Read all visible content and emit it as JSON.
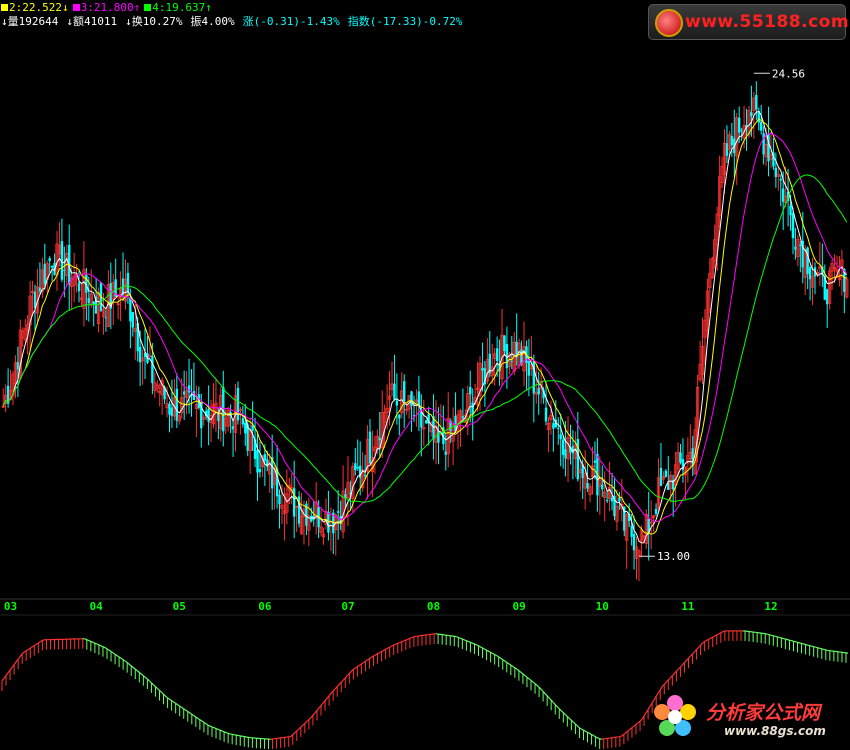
{
  "header": {
    "row1": [
      {
        "label": "2:22.522",
        "arrow": "↓",
        "color": "#ffff00"
      },
      {
        "label": "3:21.800",
        "arrow": "↑",
        "color": "#ff00ff"
      },
      {
        "label": "4:19.637",
        "arrow": "↑",
        "color": "#00ff00"
      }
    ],
    "row2": [
      {
        "label": "量192644",
        "arrow": "↓",
        "color": "#ffffff"
      },
      {
        "label": "额41011",
        "arrow": "↓",
        "color": "#ffffff"
      },
      {
        "label": "换10.27%",
        "arrow": "↓",
        "color": "#ffffff"
      },
      {
        "label": "振4.00%",
        "arrow": "",
        "color": "#ffffff"
      },
      {
        "label": "涨(-0.31)-1.43%",
        "arrow": "",
        "color": "#00ffff"
      },
      {
        "label": "指数(-17.33)-0.72%",
        "arrow": "",
        "color": "#00ffff"
      }
    ]
  },
  "watermarks": {
    "top_right": "www.55188.com",
    "bottom_right": "分析家公式网",
    "bottom_url": "www.88gs.com"
  },
  "colors": {
    "up": "#ff3232",
    "down": "#00ffff",
    "ma_short": "#ffffff",
    "ma2": "#ffff00",
    "ma3": "#ff00ff",
    "ma4": "#00ff00",
    "axis_label": "#00ff00",
    "osc_up": "#ff3232",
    "osc_down": "#66ff66"
  },
  "chart_data": {
    "type": "candlestick",
    "x_month_labels": [
      "03",
      "04",
      "05",
      "06",
      "07",
      "08",
      "09",
      "10",
      "11",
      "12"
    ],
    "ylim": [
      12.0,
      25.5
    ],
    "annotations": [
      {
        "text": "24.56",
        "value": 24.56,
        "kind": "high"
      },
      {
        "text": "13.00",
        "value": 13.0,
        "kind": "low"
      }
    ],
    "close_anchors": [
      [
        0,
        16.6
      ],
      [
        4,
        17.4
      ],
      [
        12,
        19.2
      ],
      [
        20,
        20.2
      ],
      [
        30,
        19.6
      ],
      [
        40,
        19.0
      ],
      [
        50,
        19.4
      ],
      [
        58,
        17.6
      ],
      [
        68,
        16.6
      ],
      [
        80,
        16.5
      ],
      [
        95,
        16.4
      ],
      [
        108,
        15.0
      ],
      [
        120,
        14.2
      ],
      [
        135,
        13.9
      ],
      [
        148,
        15.3
      ],
      [
        158,
        16.8
      ],
      [
        168,
        16.4
      ],
      [
        178,
        15.6
      ],
      [
        188,
        16.3
      ],
      [
        200,
        17.8
      ],
      [
        210,
        18.0
      ],
      [
        222,
        16.6
      ],
      [
        235,
        15.2
      ],
      [
        245,
        14.8
      ],
      [
        255,
        13.6
      ],
      [
        262,
        13.4
      ],
      [
        268,
        14.5
      ],
      [
        275,
        15.0
      ],
      [
        282,
        15.5
      ],
      [
        290,
        20.5
      ],
      [
        295,
        22.5
      ],
      [
        305,
        23.8
      ],
      [
        315,
        22.5
      ],
      [
        325,
        20.6
      ],
      [
        335,
        19.4
      ],
      [
        345,
        19.8
      ]
    ],
    "ma_periods": [
      5,
      10,
      20,
      40
    ],
    "oscillator": {
      "type": "histogram",
      "values": [
        0.1,
        0.6,
        0.84,
        0.85,
        0.86,
        0.7,
        0.45,
        0.15,
        -0.2,
        -0.45,
        -0.7,
        -0.85,
        -0.92,
        -0.95,
        -0.9,
        -0.55,
        -0.1,
        0.3,
        0.55,
        0.75,
        0.9,
        0.95,
        0.9,
        0.75,
        0.55,
        0.3,
        0.0,
        -0.4,
        -0.75,
        -0.95,
        -0.9,
        -0.6,
        0.0,
        0.4,
        0.8,
        1.0,
        1.0,
        0.95,
        0.85,
        0.75,
        0.65,
        0.6
      ],
      "ylim": [
        -1,
        1
      ]
    }
  }
}
